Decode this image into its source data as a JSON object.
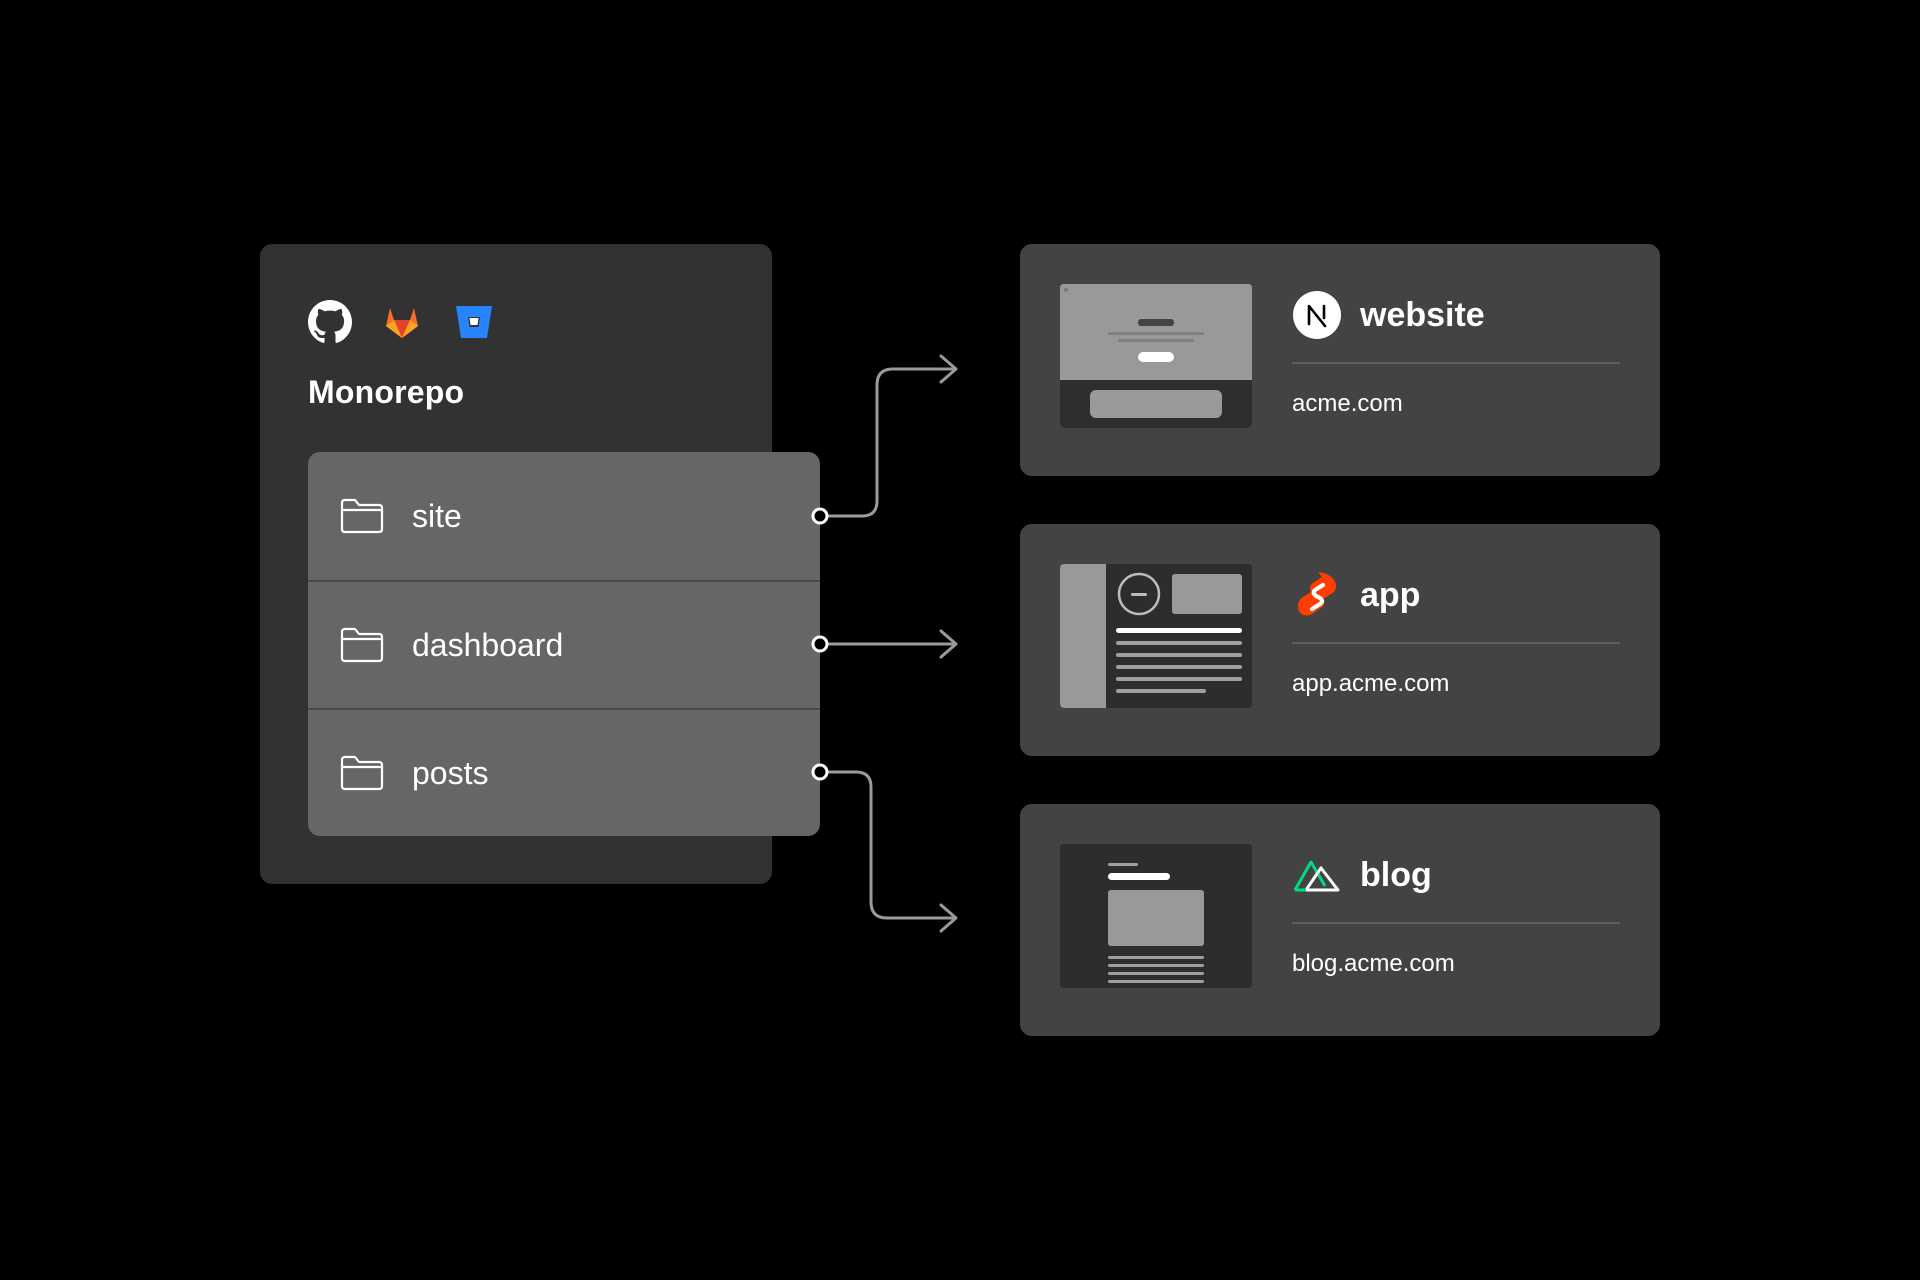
{
  "repository": {
    "title": "Monorepo",
    "providers": [
      "github-icon",
      "gitlab-icon",
      "bitbucket-icon"
    ],
    "folders": [
      {
        "label": "site",
        "icon": "folder-icon"
      },
      {
        "label": "dashboard",
        "icon": "folder-icon"
      },
      {
        "label": "posts",
        "icon": "folder-icon"
      }
    ]
  },
  "deployments": [
    {
      "name": "website",
      "url": "acme.com",
      "framework_icon": "nextjs-icon"
    },
    {
      "name": "app",
      "url": "app.acme.com",
      "framework_icon": "svelte-icon"
    },
    {
      "name": "blog",
      "url": "blog.acme.com",
      "framework_icon": "nuxt-icon"
    }
  ],
  "colors": {
    "background": "#000000",
    "repo_card": "#323232",
    "folder_list": "#666666",
    "deploy_card": "#434343",
    "connector": "#9a9a9a",
    "gitlab": "#FC6D26",
    "bitbucket": "#2684FF",
    "svelte": "#FF3E00",
    "nuxt": "#00DC82"
  }
}
